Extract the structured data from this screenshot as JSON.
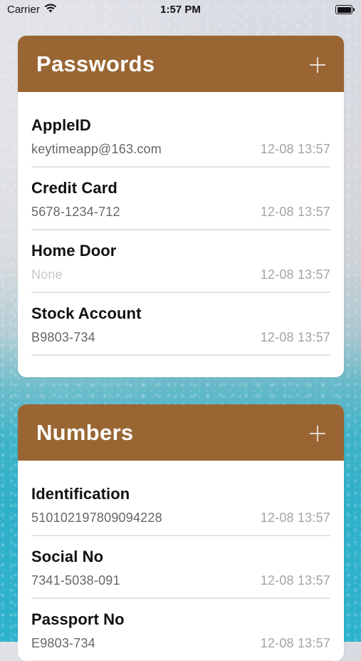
{
  "status_bar": {
    "carrier": "Carrier",
    "time": "1:57 PM",
    "battery_level": 1.0
  },
  "theme": {
    "header_color": "#996633"
  },
  "sections": [
    {
      "title": "Passwords",
      "add_icon": "plus-icon",
      "items": [
        {
          "title": "AppleID",
          "value": "keytimeapp@163.com",
          "time": "12-08 13:57"
        },
        {
          "title": "Credit Card",
          "value": "5678-1234-712",
          "time": "12-08 13:57"
        },
        {
          "title": "Home Door",
          "value": "None",
          "time": "12-08 13:57"
        },
        {
          "title": "Stock Account",
          "value": "B9803-734",
          "time": "12-08 13:57"
        }
      ]
    },
    {
      "title": "Numbers",
      "add_icon": "plus-icon",
      "items": [
        {
          "title": "Identification",
          "value": "510102197809094228",
          "time": "12-08 13:57"
        },
        {
          "title": "Social No",
          "value": "7341-5038-091",
          "time": "12-08 13:57"
        },
        {
          "title": "Passport No",
          "value": "E9803-734",
          "time": "12-08 13:57"
        }
      ]
    }
  ]
}
